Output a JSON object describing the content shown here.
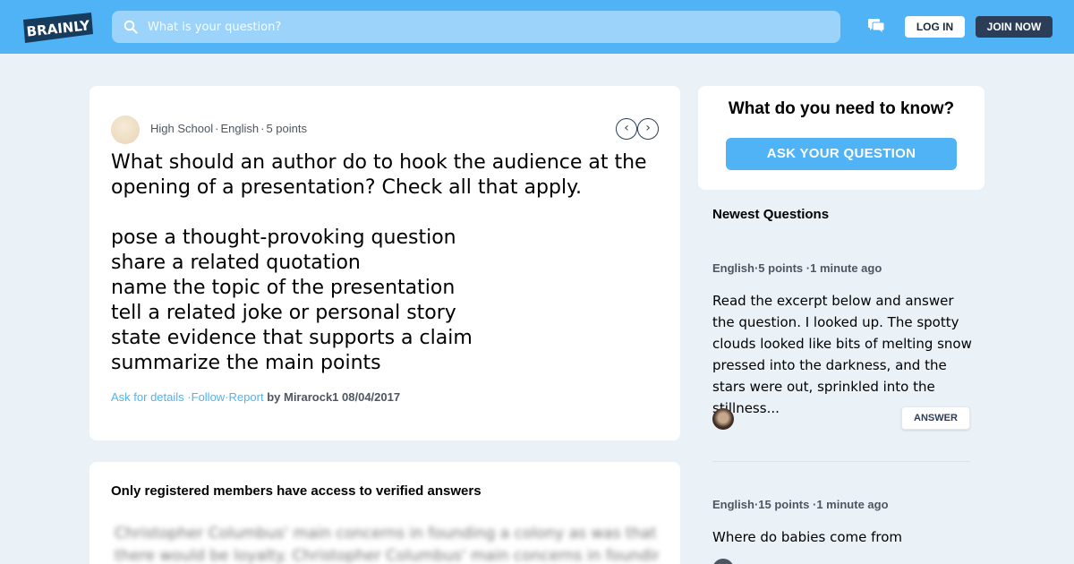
{
  "header": {
    "logo_text": "BRAINLY",
    "search_placeholder": "What is your question?",
    "login_label": "LOG IN",
    "join_label": "JOIN NOW",
    "icons": [
      "search-icon",
      "chat-icon"
    ]
  },
  "question": {
    "level": "High School",
    "subject": "English",
    "points": "5 points",
    "dot": "·",
    "lines": [
      "What should an author do to hook the audience at the",
      "opening of a presentation? Check all that apply.",
      "",
      "pose a thought-provoking question",
      "share a related quotation",
      "name the topic of the presentation",
      "tell a related joke or personal story",
      "state evidence that supports a claim",
      "summarize the main points"
    ],
    "ask_details": "Ask for details",
    "follow": "Follow",
    "report": "Report",
    "by_label": "by Mirarock1 08/04/2017",
    "prev_arrow": "‹",
    "next_arrow": "›"
  },
  "answers": {
    "title": "Only registered members have access to verified answers",
    "blurred_lines": [
      "Christopher Columbus' main concerns in founding a colony as was that",
      "there would be loyalty. Christopher Columbus' main concerns in founding a"
    ]
  },
  "sidebar": {
    "ask_heading": "What do you need to know?",
    "ask_button": "ASK YOUR QUESTION",
    "newest_title": "Newest Questions",
    "items": [
      {
        "subject": "English",
        "points": "5 points",
        "time": "1 minute ago",
        "text": "Read the excerpt below and answer the question. I looked up. The spotty clouds looked like bits of melting snow pressed into the darkness, and the stars were out, sprinkled into the stillness...",
        "answer_label": "ANSWER"
      },
      {
        "subject": "English",
        "points": "15 points",
        "time": "1 minute ago",
        "text": "Where do babies come from"
      }
    ]
  },
  "colors": {
    "topbar": "#4fb3f6",
    "search": "#9bd3fa",
    "join_button": "#2c3e57",
    "link": "#4fb3f6",
    "page_bg": "#ebf2f7"
  }
}
